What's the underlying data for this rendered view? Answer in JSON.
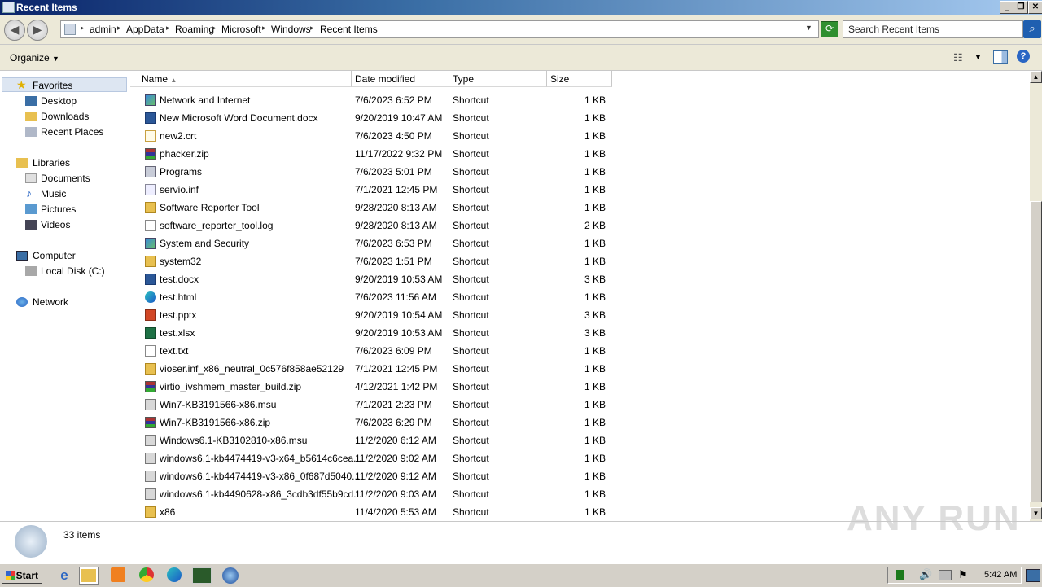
{
  "window": {
    "title": "Recent Items"
  },
  "breadcrumb": [
    "admin",
    "AppData",
    "Roaming",
    "Microsoft",
    "Windows",
    "Recent Items"
  ],
  "search": {
    "placeholder": "Search Recent Items"
  },
  "toolbar": {
    "organize_label": "Organize"
  },
  "sidebar": {
    "favorites": "Favorites",
    "favorites_items": [
      "Desktop",
      "Downloads",
      "Recent Places"
    ],
    "libraries": "Libraries",
    "libraries_items": [
      "Documents",
      "Music",
      "Pictures",
      "Videos"
    ],
    "computer": "Computer",
    "computer_items": [
      "Local Disk (C:)"
    ],
    "network": "Network"
  },
  "columns": {
    "name": "Name",
    "date": "Date modified",
    "type": "Type",
    "size": "Size"
  },
  "files": [
    {
      "name": "Network and Internet",
      "date": "7/6/2023 6:52 PM",
      "type": "Shortcut",
      "size": "1 KB",
      "icon": "control-panel-icon"
    },
    {
      "name": "New Microsoft Word Document.docx",
      "date": "9/20/2019 10:47 AM",
      "type": "Shortcut",
      "size": "1 KB",
      "icon": "word-icon"
    },
    {
      "name": "new2.crt",
      "date": "7/6/2023 4:50 PM",
      "type": "Shortcut",
      "size": "1 KB",
      "icon": "certificate-icon"
    },
    {
      "name": "phacker.zip",
      "date": "11/17/2022 9:32 PM",
      "type": "Shortcut",
      "size": "1 KB",
      "icon": "winrar-icon"
    },
    {
      "name": "Programs",
      "date": "7/6/2023 5:01 PM",
      "type": "Shortcut",
      "size": "1 KB",
      "icon": "programs-icon"
    },
    {
      "name": "servio.inf",
      "date": "7/1/2021 12:45 PM",
      "type": "Shortcut",
      "size": "1 KB",
      "icon": "inf-icon"
    },
    {
      "name": "Software Reporter Tool",
      "date": "9/28/2020 8:13 AM",
      "type": "Shortcut",
      "size": "1 KB",
      "icon": "folder-icon"
    },
    {
      "name": "software_reporter_tool.log",
      "date": "9/28/2020 8:13 AM",
      "type": "Shortcut",
      "size": "2 KB",
      "icon": "text-file-icon"
    },
    {
      "name": "System and Security",
      "date": "7/6/2023 6:53 PM",
      "type": "Shortcut",
      "size": "1 KB",
      "icon": "control-panel-icon"
    },
    {
      "name": "system32",
      "date": "7/6/2023 1:51 PM",
      "type": "Shortcut",
      "size": "1 KB",
      "icon": "folder-icon"
    },
    {
      "name": "test.docx",
      "date": "9/20/2019 10:53 AM",
      "type": "Shortcut",
      "size": "3 KB",
      "icon": "word-icon"
    },
    {
      "name": "test.html",
      "date": "7/6/2023 11:56 AM",
      "type": "Shortcut",
      "size": "1 KB",
      "icon": "edge-icon"
    },
    {
      "name": "test.pptx",
      "date": "9/20/2019 10:54 AM",
      "type": "Shortcut",
      "size": "3 KB",
      "icon": "powerpoint-icon"
    },
    {
      "name": "test.xlsx",
      "date": "9/20/2019 10:53 AM",
      "type": "Shortcut",
      "size": "3 KB",
      "icon": "excel-icon"
    },
    {
      "name": "text.txt",
      "date": "7/6/2023 6:09 PM",
      "type": "Shortcut",
      "size": "1 KB",
      "icon": "text-file-icon"
    },
    {
      "name": "vioser.inf_x86_neutral_0c576f858ae52129",
      "date": "7/1/2021 12:45 PM",
      "type": "Shortcut",
      "size": "1 KB",
      "icon": "folder-icon"
    },
    {
      "name": "virtio_ivshmem_master_build.zip",
      "date": "4/12/2021 1:42 PM",
      "type": "Shortcut",
      "size": "1 KB",
      "icon": "winrar-icon"
    },
    {
      "name": "Win7-KB3191566-x86.msu",
      "date": "7/1/2021 2:23 PM",
      "type": "Shortcut",
      "size": "1 KB",
      "icon": "msu-icon"
    },
    {
      "name": "Win7-KB3191566-x86.zip",
      "date": "7/6/2023 6:29 PM",
      "type": "Shortcut",
      "size": "1 KB",
      "icon": "winrar-icon"
    },
    {
      "name": "Windows6.1-KB3102810-x86.msu",
      "date": "11/2/2020 6:12 AM",
      "type": "Shortcut",
      "size": "1 KB",
      "icon": "msu-icon"
    },
    {
      "name": "windows6.1-kb4474419-v3-x64_b5614c6cea...",
      "date": "11/2/2020 9:02 AM",
      "type": "Shortcut",
      "size": "1 KB",
      "icon": "msu-icon"
    },
    {
      "name": "windows6.1-kb4474419-v3-x86_0f687d5040...",
      "date": "11/2/2020 9:12 AM",
      "type": "Shortcut",
      "size": "1 KB",
      "icon": "msu-icon"
    },
    {
      "name": "windows6.1-kb4490628-x86_3cdb3df55b9cd...",
      "date": "11/2/2020 9:03 AM",
      "type": "Shortcut",
      "size": "1 KB",
      "icon": "msu-icon"
    },
    {
      "name": "x86",
      "date": "11/4/2020 5:53 AM",
      "type": "Shortcut",
      "size": "1 KB",
      "icon": "folder-icon"
    }
  ],
  "details": {
    "count": "33 items"
  },
  "taskbar": {
    "start_label": "Start",
    "clock": "5:42 AM"
  },
  "watermark": "ANY RUN",
  "colors": {
    "folder": "#e8c050",
    "selection": "#dde6f2",
    "accent": "#0a246a"
  }
}
